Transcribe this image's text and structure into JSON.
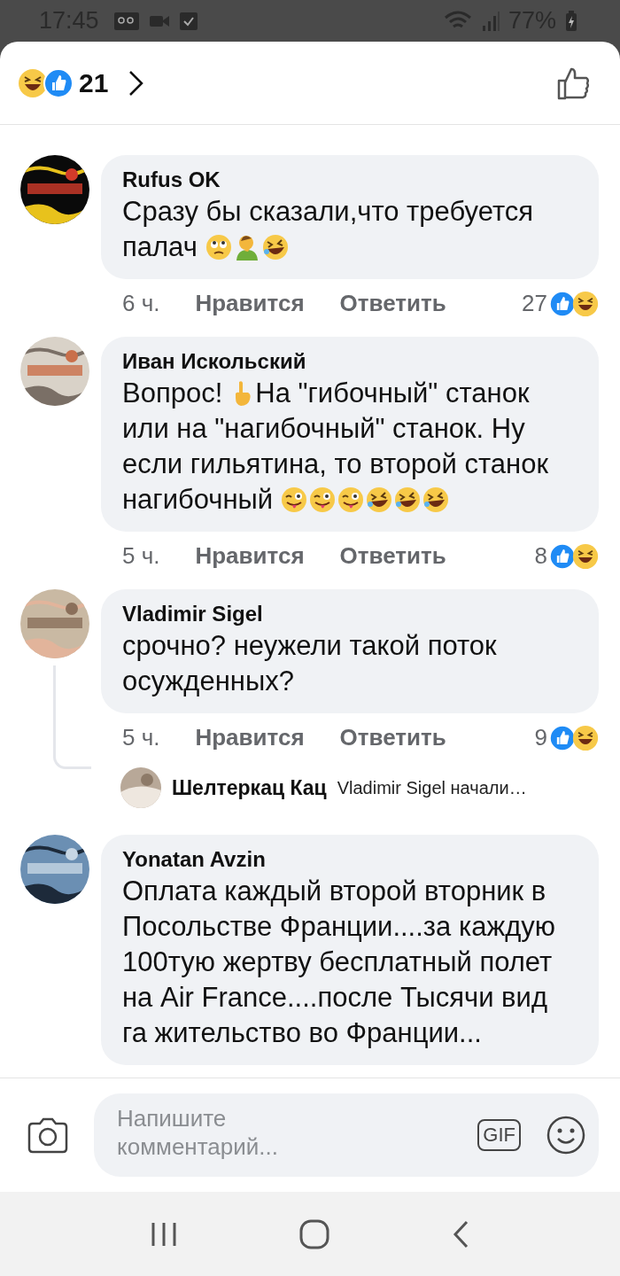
{
  "status_bar": {
    "time": "17:45",
    "battery": "77%"
  },
  "header": {
    "reaction_count": "21"
  },
  "comments": [
    {
      "author": "Rufus OK",
      "body": [
        {
          "kind": "text",
          "text": "Сразу бы сказали,что требуется"
        },
        {
          "kind": "text",
          "text": "палач"
        },
        {
          "kind": "eyeroll"
        },
        {
          "kind": "facepalm"
        },
        {
          "kind": "rofl"
        }
      ],
      "time": "6 ч.",
      "like": "Нравится",
      "reply": "Ответить",
      "reactions": "27"
    },
    {
      "author": "Иван Искольский",
      "body": [
        {
          "kind": "text",
          "text": "Вопрос!"
        },
        {
          "kind": "pointer"
        },
        {
          "kind": "text",
          "text": "На \"гибочный\" станок"
        },
        {
          "kind": "text",
          "text": "или на \"нагибочный\" станок. Ну"
        },
        {
          "kind": "text",
          "text": "если гильятина, то второй станок"
        },
        {
          "kind": "text",
          "text": "нагибочный"
        },
        {
          "kind": "wink"
        },
        {
          "kind": "wink"
        },
        {
          "kind": "wink"
        },
        {
          "kind": "rofl"
        },
        {
          "kind": "rofl"
        },
        {
          "kind": "rofl"
        }
      ],
      "time": "5 ч.",
      "like": "Нравится",
      "reply": "Ответить",
      "reactions": "8"
    },
    {
      "author": "Vladimir Sigel",
      "body": [
        {
          "kind": "text",
          "text": "срочно? неужели такой поток осужденных?"
        }
      ],
      "time": "5 ч.",
      "like": "Нравится",
      "reply": "Ответить",
      "reactions": "9",
      "reply_preview": {
        "author": "Шелтеркац Кац",
        "text": "Vladimir Sigel начали…"
      }
    },
    {
      "author": "Yonatan Avzin",
      "body": [
        {
          "kind": "text",
          "text": "Оплата каждый второй вторник в Посольстве Франции....за каждую 100тую жертву бесплатный полет на Air France....после Тысячи вид га жительство во Франции..."
        }
      ]
    }
  ],
  "composer": {
    "placeholder": "Напишите комментарий...",
    "gif": "GIF"
  }
}
